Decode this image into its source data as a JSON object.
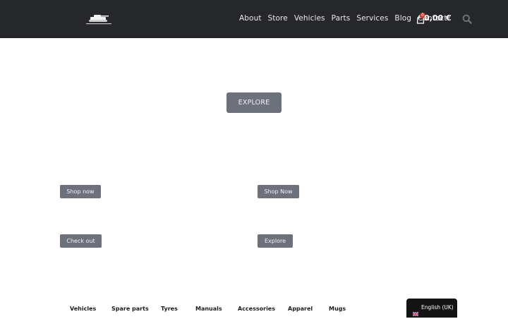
{
  "header": {
    "logo_icon": "tank-logo-icon",
    "nav": [
      {
        "label": "About"
      },
      {
        "label": "Store"
      },
      {
        "label": "Vehicles"
      },
      {
        "label": "Parts"
      },
      {
        "label": "Services"
      },
      {
        "label": "Blog"
      },
      {
        "label": "Contact"
      }
    ],
    "cart": {
      "count": "0",
      "total": "0,00 €",
      "icon": "shopping-bag-icon"
    },
    "search_icon": "search-icon"
  },
  "main": {
    "hero_button": "EXPLORE",
    "promo_buttons": [
      {
        "label": "Shop now"
      },
      {
        "label": "Shop Now"
      },
      {
        "label": "Check out"
      },
      {
        "label": "Explore"
      }
    ]
  },
  "categories": [
    {
      "label": "Vehicles"
    },
    {
      "label": "Spare parts"
    },
    {
      "label": "Tyres"
    },
    {
      "label": "Manuals"
    },
    {
      "label": "Accessories"
    },
    {
      "label": "Apparel"
    },
    {
      "label": "Mugs"
    }
  ],
  "language": {
    "label": "English (UK)",
    "flag": "uk-flag-icon"
  },
  "colors": {
    "header_bg": "#25272b",
    "button_bg": "#6d717c",
    "badge": "#d63a2f",
    "lang_bg": "#141414"
  }
}
